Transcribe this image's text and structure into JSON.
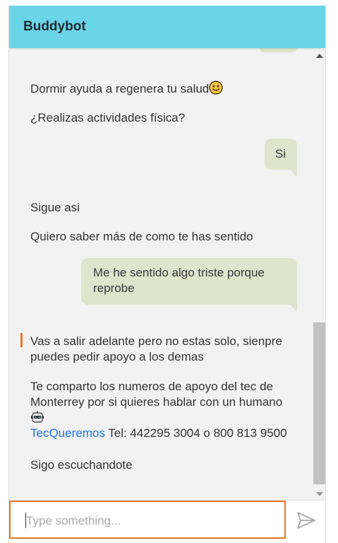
{
  "header": {
    "title": "Buddybot"
  },
  "messages": {
    "bot_1": "Dormir ayuda a regenera tu salud",
    "bot_2": "¿Realizas actividades física?",
    "user_1": "Si",
    "bot_3": "Sigue asi",
    "bot_4": "Quiero saber más de como te has sentido",
    "user_2": "Me he sentido algo triste porque reprobe",
    "bot_5": "Vas a salir adelante pero no estas solo, sienpre puedes pedir apoyo a los demas",
    "bot_6": "Te comparto los numeros de apoyo del tec de Monterrey por si quieres hablar con un humano",
    "bot_7_link": "TecQueremos",
    "bot_7_rest": " Tel: 442295 3004 o 800 813 9500",
    "bot_8": "Sigo escuchandote"
  },
  "composer": {
    "placeholder": "Type something..."
  },
  "icons": {
    "smiley": "smiley-emoji-icon",
    "robot": "robot-emoji-icon",
    "send": "send-icon"
  },
  "colors": {
    "header": "#6ad4e8",
    "user_bubble": "#dfe4cc",
    "accent": "#e87722",
    "link": "#1a73e8"
  }
}
